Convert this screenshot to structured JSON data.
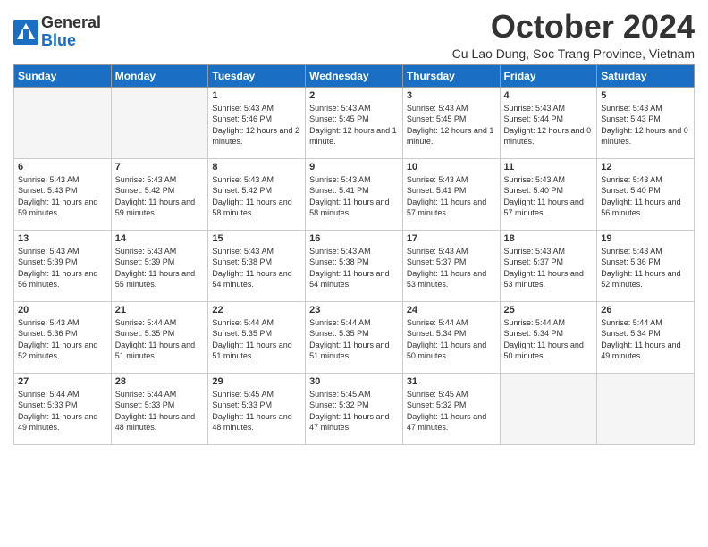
{
  "header": {
    "logo_line1": "General",
    "logo_line2": "Blue",
    "month_title": "October 2024",
    "location": "Cu Lao Dung, Soc Trang Province, Vietnam"
  },
  "weekdays": [
    "Sunday",
    "Monday",
    "Tuesday",
    "Wednesday",
    "Thursday",
    "Friday",
    "Saturday"
  ],
  "weeks": [
    [
      {
        "day": "",
        "empty": true
      },
      {
        "day": "",
        "empty": true
      },
      {
        "day": "1",
        "sunrise": "5:43 AM",
        "sunset": "5:46 PM",
        "daylight": "12 hours and 2 minutes."
      },
      {
        "day": "2",
        "sunrise": "5:43 AM",
        "sunset": "5:45 PM",
        "daylight": "12 hours and 1 minute."
      },
      {
        "day": "3",
        "sunrise": "5:43 AM",
        "sunset": "5:45 PM",
        "daylight": "12 hours and 1 minute."
      },
      {
        "day": "4",
        "sunrise": "5:43 AM",
        "sunset": "5:44 PM",
        "daylight": "12 hours and 0 minutes."
      },
      {
        "day": "5",
        "sunrise": "5:43 AM",
        "sunset": "5:43 PM",
        "daylight": "12 hours and 0 minutes."
      }
    ],
    [
      {
        "day": "6",
        "sunrise": "5:43 AM",
        "sunset": "5:43 PM",
        "daylight": "11 hours and 59 minutes."
      },
      {
        "day": "7",
        "sunrise": "5:43 AM",
        "sunset": "5:42 PM",
        "daylight": "11 hours and 59 minutes."
      },
      {
        "day": "8",
        "sunrise": "5:43 AM",
        "sunset": "5:42 PM",
        "daylight": "11 hours and 58 minutes."
      },
      {
        "day": "9",
        "sunrise": "5:43 AM",
        "sunset": "5:41 PM",
        "daylight": "11 hours and 58 minutes."
      },
      {
        "day": "10",
        "sunrise": "5:43 AM",
        "sunset": "5:41 PM",
        "daylight": "11 hours and 57 minutes."
      },
      {
        "day": "11",
        "sunrise": "5:43 AM",
        "sunset": "5:40 PM",
        "daylight": "11 hours and 57 minutes."
      },
      {
        "day": "12",
        "sunrise": "5:43 AM",
        "sunset": "5:40 PM",
        "daylight": "11 hours and 56 minutes."
      }
    ],
    [
      {
        "day": "13",
        "sunrise": "5:43 AM",
        "sunset": "5:39 PM",
        "daylight": "11 hours and 56 minutes."
      },
      {
        "day": "14",
        "sunrise": "5:43 AM",
        "sunset": "5:39 PM",
        "daylight": "11 hours and 55 minutes."
      },
      {
        "day": "15",
        "sunrise": "5:43 AM",
        "sunset": "5:38 PM",
        "daylight": "11 hours and 54 minutes."
      },
      {
        "day": "16",
        "sunrise": "5:43 AM",
        "sunset": "5:38 PM",
        "daylight": "11 hours and 54 minutes."
      },
      {
        "day": "17",
        "sunrise": "5:43 AM",
        "sunset": "5:37 PM",
        "daylight": "11 hours and 53 minutes."
      },
      {
        "day": "18",
        "sunrise": "5:43 AM",
        "sunset": "5:37 PM",
        "daylight": "11 hours and 53 minutes."
      },
      {
        "day": "19",
        "sunrise": "5:43 AM",
        "sunset": "5:36 PM",
        "daylight": "11 hours and 52 minutes."
      }
    ],
    [
      {
        "day": "20",
        "sunrise": "5:43 AM",
        "sunset": "5:36 PM",
        "daylight": "11 hours and 52 minutes."
      },
      {
        "day": "21",
        "sunrise": "5:44 AM",
        "sunset": "5:35 PM",
        "daylight": "11 hours and 51 minutes."
      },
      {
        "day": "22",
        "sunrise": "5:44 AM",
        "sunset": "5:35 PM",
        "daylight": "11 hours and 51 minutes."
      },
      {
        "day": "23",
        "sunrise": "5:44 AM",
        "sunset": "5:35 PM",
        "daylight": "11 hours and 51 minutes."
      },
      {
        "day": "24",
        "sunrise": "5:44 AM",
        "sunset": "5:34 PM",
        "daylight": "11 hours and 50 minutes."
      },
      {
        "day": "25",
        "sunrise": "5:44 AM",
        "sunset": "5:34 PM",
        "daylight": "11 hours and 50 minutes."
      },
      {
        "day": "26",
        "sunrise": "5:44 AM",
        "sunset": "5:34 PM",
        "daylight": "11 hours and 49 minutes."
      }
    ],
    [
      {
        "day": "27",
        "sunrise": "5:44 AM",
        "sunset": "5:33 PM",
        "daylight": "11 hours and 49 minutes."
      },
      {
        "day": "28",
        "sunrise": "5:44 AM",
        "sunset": "5:33 PM",
        "daylight": "11 hours and 48 minutes."
      },
      {
        "day": "29",
        "sunrise": "5:45 AM",
        "sunset": "5:33 PM",
        "daylight": "11 hours and 48 minutes."
      },
      {
        "day": "30",
        "sunrise": "5:45 AM",
        "sunset": "5:32 PM",
        "daylight": "11 hours and 47 minutes."
      },
      {
        "day": "31",
        "sunrise": "5:45 AM",
        "sunset": "5:32 PM",
        "daylight": "11 hours and 47 minutes."
      },
      {
        "day": "",
        "empty": true
      },
      {
        "day": "",
        "empty": true
      }
    ]
  ]
}
